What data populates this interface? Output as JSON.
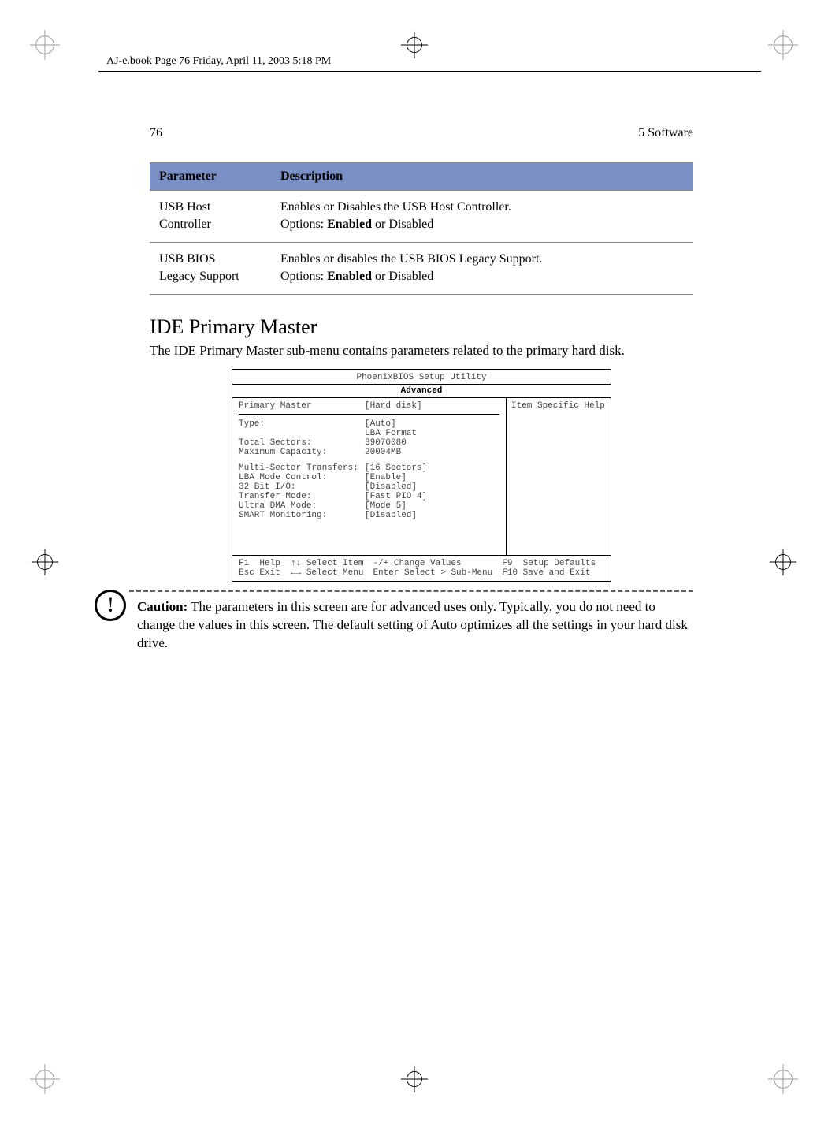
{
  "meta": {
    "book_line": "AJ-e.book  Page 76  Friday, April 11, 2003  5:18 PM"
  },
  "runhead": {
    "page_no": "76",
    "section": "5 Software"
  },
  "table": {
    "headers": {
      "param": "Parameter",
      "desc": "Description"
    },
    "rows": [
      {
        "param1": "USB Host",
        "param2": "Controller",
        "d1": "Enables or Disables the USB Host Controller.",
        "d2a": "Options: ",
        "d2b": "Enabled",
        "d2c": " or Disabled"
      },
      {
        "param1": "USB BIOS",
        "param2": "Legacy Support",
        "d1": "Enables or disables the USB BIOS Legacy Support.",
        "d2a": "Options: ",
        "d2b": "Enabled",
        "d2c": " or Disabled"
      }
    ]
  },
  "section_title": "IDE Primary Master",
  "section_body": "The IDE Primary Master sub-menu contains parameters related to the primary hard disk.",
  "bios": {
    "title": "PhoenixBIOS Setup Utility",
    "tab": "Advanced",
    "sub_label": "Primary Master",
    "sub_value": "[Hard disk]",
    "help_label": "Item Specific Help",
    "rows": [
      {
        "k": "Type:",
        "v": "[Auto]"
      },
      {
        "k": "",
        "v": "LBA Format"
      },
      {
        "k": "Total Sectors:",
        "v": "39070080"
      },
      {
        "k": "Maximum Capacity:",
        "v": "20004MB"
      }
    ],
    "rows2": [
      {
        "k": "Multi-Sector Transfers:",
        "v": "[16 Sectors]"
      },
      {
        "k": "LBA Mode Control:",
        "v": "[Enable]"
      },
      {
        "k": "32 Bit I/O:",
        "v": "[Disabled]"
      },
      {
        "k": "Transfer Mode:",
        "v": "[Fast PIO 4]"
      },
      {
        "k": "Ultra DMA Mode:",
        "v": "[Mode 5]"
      },
      {
        "k": "SMART Monitoring:",
        "v": "[Disabled]"
      }
    ],
    "foot": {
      "c1": "F1  Help  ↑↓ Select Item\nEsc Exit  ←→ Select Menu",
      "c2": "-/+ Change Values\nEnter Select > Sub-Menu",
      "c3": "F9  Setup Defaults\nF10 Save and Exit"
    }
  },
  "caution": {
    "label": "Caution:",
    "text": " The parameters in this screen are for advanced uses only.  Typically, you do not need to change the values in this screen.  The default setting of Auto optimizes all the settings in your hard disk drive."
  }
}
